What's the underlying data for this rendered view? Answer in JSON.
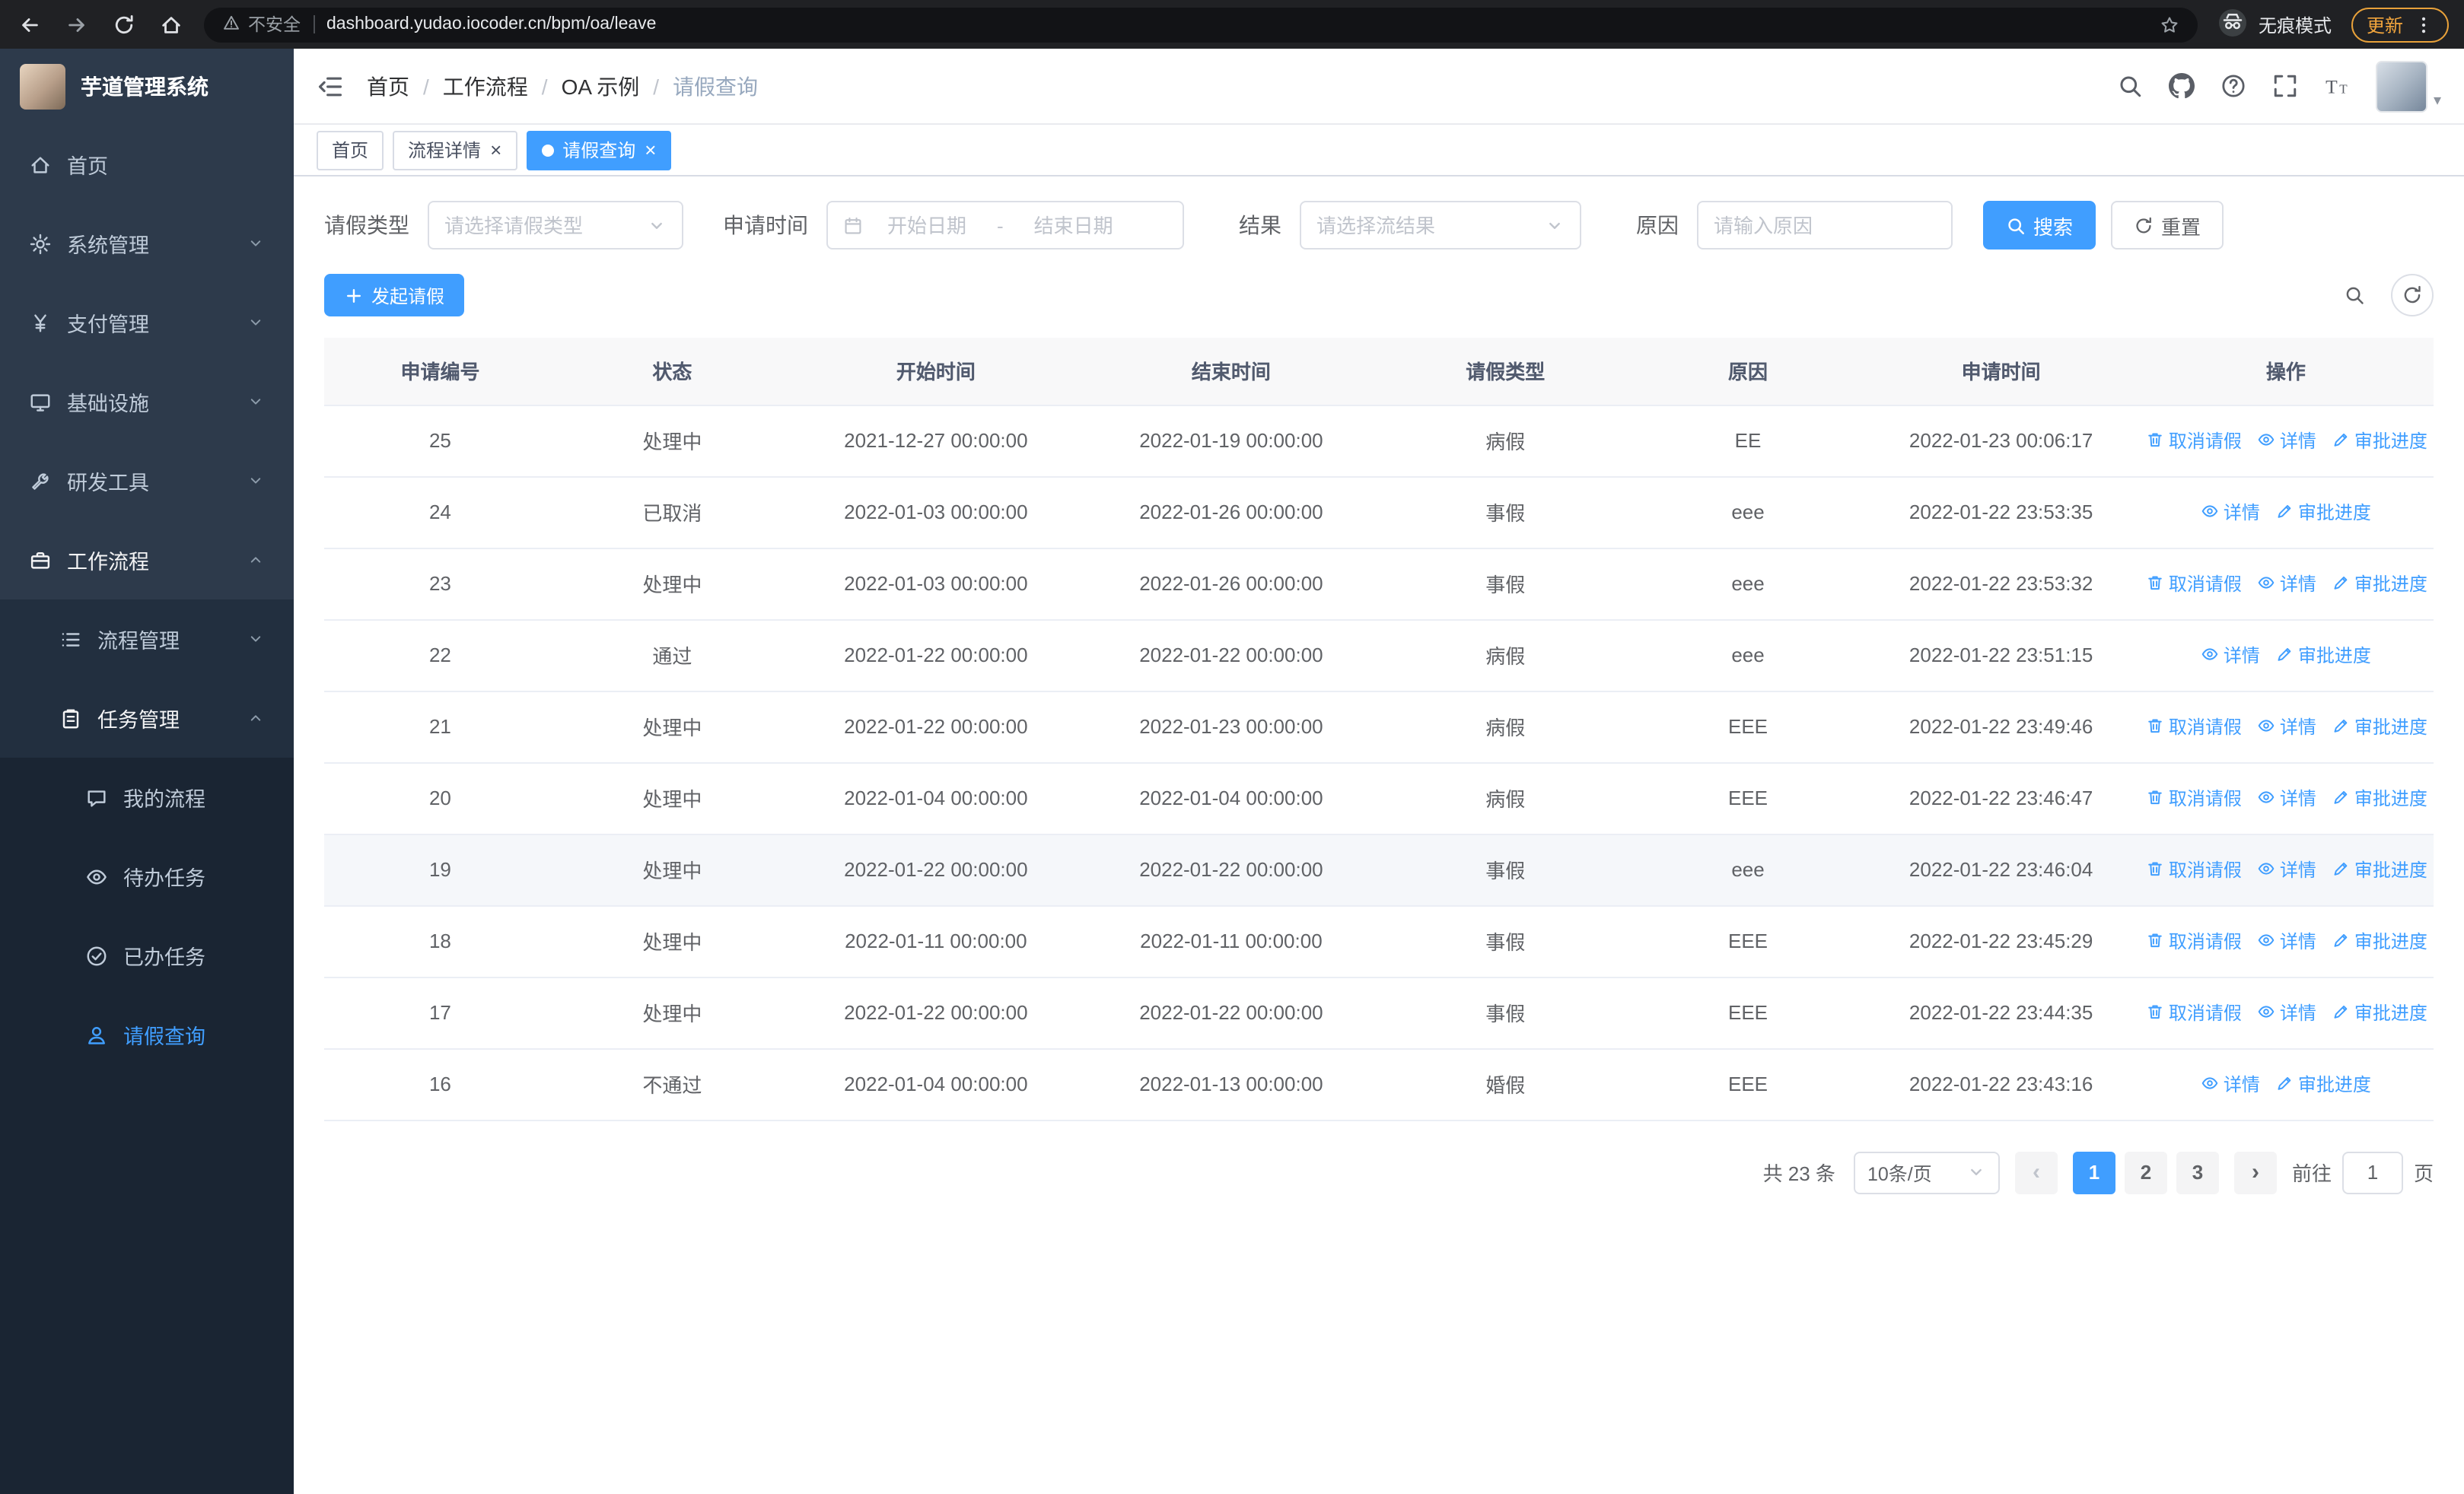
{
  "browser": {
    "security_warning": "不安全",
    "url": "dashboard.yudao.iocoder.cn/bpm/oa/leave",
    "incognito_label": "无痕模式",
    "update_label": "更新"
  },
  "ui": {
    "close_glyph": "×",
    "prev_glyph": "‹",
    "next_glyph": "›",
    "avatar_caret": "▾",
    "range_separator": "-"
  },
  "sidebar": {
    "logo_title": "芋道管理系统",
    "items": [
      {
        "key": "home",
        "label": "首页",
        "icon": "home",
        "level": 1
      },
      {
        "key": "system",
        "label": "系统管理",
        "icon": "gear",
        "level": 1,
        "chevron": "down"
      },
      {
        "key": "payment",
        "label": "支付管理",
        "icon": "yen",
        "level": 1,
        "chevron": "down"
      },
      {
        "key": "infrastructure",
        "label": "基础设施",
        "icon": "monitor",
        "level": 1,
        "chevron": "down"
      },
      {
        "key": "dev-tools",
        "label": "研发工具",
        "icon": "wrench",
        "level": 1,
        "chevron": "down"
      },
      {
        "key": "workflow",
        "label": "工作流程",
        "icon": "briefcase",
        "level": 1,
        "chevron": "up",
        "state": "trail"
      },
      {
        "key": "process-mgmt",
        "label": "流程管理",
        "icon": "list",
        "level": 2,
        "chevron": "down"
      },
      {
        "key": "task-mgmt",
        "label": "任务管理",
        "icon": "clipboard",
        "level": 2,
        "chevron": "up",
        "state": "trail"
      },
      {
        "key": "my-process",
        "label": "我的流程",
        "icon": "chat",
        "level": 3
      },
      {
        "key": "todo-task",
        "label": "待办任务",
        "icon": "eye",
        "level": 3
      },
      {
        "key": "done-task",
        "label": "已办任务",
        "icon": "check",
        "level": 3
      },
      {
        "key": "leave-query",
        "label": "请假查询",
        "icon": "user",
        "level": 3,
        "state": "active"
      }
    ]
  },
  "breadcrumb": {
    "items": [
      "首页",
      "工作流程",
      "OA 示例",
      "请假查询"
    ],
    "separator": "/"
  },
  "tabs": [
    {
      "key": "home",
      "label": "首页",
      "closable": false,
      "active": false
    },
    {
      "key": "process-detail",
      "label": "流程详情",
      "closable": true,
      "active": false
    },
    {
      "key": "leave-query",
      "label": "请假查询",
      "closable": true,
      "active": true
    }
  ],
  "filters": {
    "leave_type_label": "请假类型",
    "leave_type_placeholder": "请选择请假类型",
    "apply_time_label": "申请时间",
    "start_date_placeholder": "开始日期",
    "end_date_placeholder": "结束日期",
    "result_label": "结果",
    "result_placeholder": "请选择流结果",
    "reason_label": "原因",
    "reason_placeholder": "请输入原因",
    "search_label": "搜索",
    "reset_label": "重置"
  },
  "toolbar": {
    "create_label": "发起请假"
  },
  "table": {
    "columns": [
      "申请编号",
      "状态",
      "开始时间",
      "结束时间",
      "请假类型",
      "原因",
      "申请时间",
      "操作"
    ],
    "actions": {
      "cancel": "取消请假",
      "detail": "详情",
      "progress": "审批进度"
    },
    "rows": [
      {
        "id": "25",
        "status": "处理中",
        "start": "2021-12-27 00:00:00",
        "end": "2022-01-19 00:00:00",
        "type": "病假",
        "reason": "EE",
        "applied": "2022-01-23 00:06:17",
        "cancelable": true
      },
      {
        "id": "24",
        "status": "已取消",
        "start": "2022-01-03 00:00:00",
        "end": "2022-01-26 00:00:00",
        "type": "事假",
        "reason": "eee",
        "applied": "2022-01-22 23:53:35",
        "cancelable": false
      },
      {
        "id": "23",
        "status": "处理中",
        "start": "2022-01-03 00:00:00",
        "end": "2022-01-26 00:00:00",
        "type": "事假",
        "reason": "eee",
        "applied": "2022-01-22 23:53:32",
        "cancelable": true
      },
      {
        "id": "22",
        "status": "通过",
        "start": "2022-01-22 00:00:00",
        "end": "2022-01-22 00:00:00",
        "type": "病假",
        "reason": "eee",
        "applied": "2022-01-22 23:51:15",
        "cancelable": false
      },
      {
        "id": "21",
        "status": "处理中",
        "start": "2022-01-22 00:00:00",
        "end": "2022-01-23 00:00:00",
        "type": "病假",
        "reason": "EEE",
        "applied": "2022-01-22 23:49:46",
        "cancelable": true
      },
      {
        "id": "20",
        "status": "处理中",
        "start": "2022-01-04 00:00:00",
        "end": "2022-01-04 00:00:00",
        "type": "病假",
        "reason": "EEE",
        "applied": "2022-01-22 23:46:47",
        "cancelable": true
      },
      {
        "id": "19",
        "status": "处理中",
        "start": "2022-01-22 00:00:00",
        "end": "2022-01-22 00:00:00",
        "type": "事假",
        "reason": "eee",
        "applied": "2022-01-22 23:46:04",
        "cancelable": true,
        "highlight": true
      },
      {
        "id": "18",
        "status": "处理中",
        "start": "2022-01-11 00:00:00",
        "end": "2022-01-11 00:00:00",
        "type": "事假",
        "reason": "EEE",
        "applied": "2022-01-22 23:45:29",
        "cancelable": true
      },
      {
        "id": "17",
        "status": "处理中",
        "start": "2022-01-22 00:00:00",
        "end": "2022-01-22 00:00:00",
        "type": "事假",
        "reason": "EEE",
        "applied": "2022-01-22 23:44:35",
        "cancelable": true
      },
      {
        "id": "16",
        "status": "不通过",
        "start": "2022-01-04 00:00:00",
        "end": "2022-01-13 00:00:00",
        "type": "婚假",
        "reason": "EEE",
        "applied": "2022-01-22 23:43:16",
        "cancelable": false
      }
    ]
  },
  "pagination": {
    "total": "共 23 条",
    "page_size": "10条/页",
    "pages": [
      "1",
      "2",
      "3"
    ],
    "active_page": "1",
    "goto_label": "前往",
    "goto_value": "1",
    "goto_suffix": "页"
  }
}
